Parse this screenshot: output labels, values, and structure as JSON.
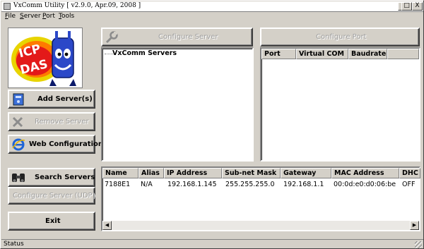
{
  "window": {
    "title": "VxComm Utility [ v2.9.0, Apr.09, 2008 ]",
    "minimize": "_",
    "maximize": "□",
    "close": "X"
  },
  "menu": {
    "file": "File",
    "server": "Server",
    "port": "Port",
    "tools": "Tools"
  },
  "logo": {
    "line1": "ICP",
    "line2": "DAS"
  },
  "left_buttons": {
    "add_server": "Add Server(s)",
    "remove_server": "Remove Server",
    "web_configuration": "Web Configuration",
    "search_servers": "Search Servers",
    "configure_server_udp": "Configure Server (UDP)",
    "exit": "Exit"
  },
  "top_buttons": {
    "configure_server": "Configure Server",
    "configure_port": "Configure Port"
  },
  "tree": {
    "root": "VxComm Servers"
  },
  "port_table": {
    "columns": [
      "Port",
      "Virtual COM",
      "Baudrate"
    ]
  },
  "server_table": {
    "columns": [
      "Name",
      "Alias",
      "IP Address",
      "Sub-net Mask",
      "Gateway",
      "MAC Address",
      "DHC"
    ],
    "rows": [
      [
        "7188E1",
        "N/A",
        "192.168.1.145",
        "255.255.255.0",
        "192.168.1.1",
        "00:0d:e0:d0:06:be",
        "OFF"
      ]
    ]
  },
  "status_bar": {
    "text": "Status"
  }
}
